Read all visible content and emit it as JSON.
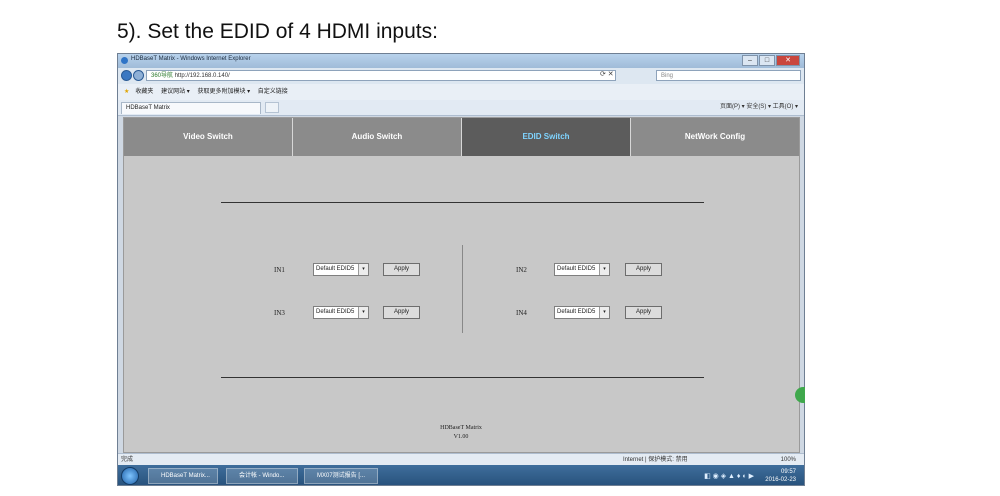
{
  "heading": "5). Set the EDID of 4 HDMI inputs:",
  "browser": {
    "title": "HDBaseT Matrix - Windows Internet Explorer",
    "address_tag": "360导航",
    "address": "http://192.168.0.140/",
    "search_placeholder": "Bing",
    "favorites": [
      "收藏夹",
      "建议网站 ▾",
      "获取更多附加模块 ▾",
      "自定义链接"
    ],
    "tab_title": "HDBaseT Matrix",
    "command_bar": "页面(P) ▾  安全(S) ▾  工具(O) ▾"
  },
  "page": {
    "tabs": [
      {
        "label": "Video Switch"
      },
      {
        "label": "Audio Switch"
      },
      {
        "label": "EDID Switch",
        "active": true
      },
      {
        "label": "NetWork Config"
      }
    ],
    "inputs": [
      {
        "label": "IN1",
        "value": "Default EDID5",
        "button": "Apply"
      },
      {
        "label": "IN2",
        "value": "Default EDID5",
        "button": "Apply"
      },
      {
        "label": "IN3",
        "value": "Default EDID5",
        "button": "Apply"
      },
      {
        "label": "IN4",
        "value": "Default EDID5",
        "button": "Apply"
      }
    ],
    "footer_title": "HDBaseT Matrix",
    "footer_version": "V1.00"
  },
  "statusbar": {
    "left": "完成",
    "zone": "Internet | 保护模式: 禁用",
    "zoom": "100%"
  },
  "taskbar": {
    "items": [
      "HDBaseT Matrix...",
      "会计帐 - Windo...",
      "MX07测试报告 [..."
    ],
    "time": "09:57",
    "date": "2016-02-23"
  },
  "colors": {
    "tab_inactive": "#8b8b8b",
    "tab_active": "#5c5c5c",
    "tab_active_text": "#7fd4ff",
    "content_bg": "#c8c8c8"
  }
}
